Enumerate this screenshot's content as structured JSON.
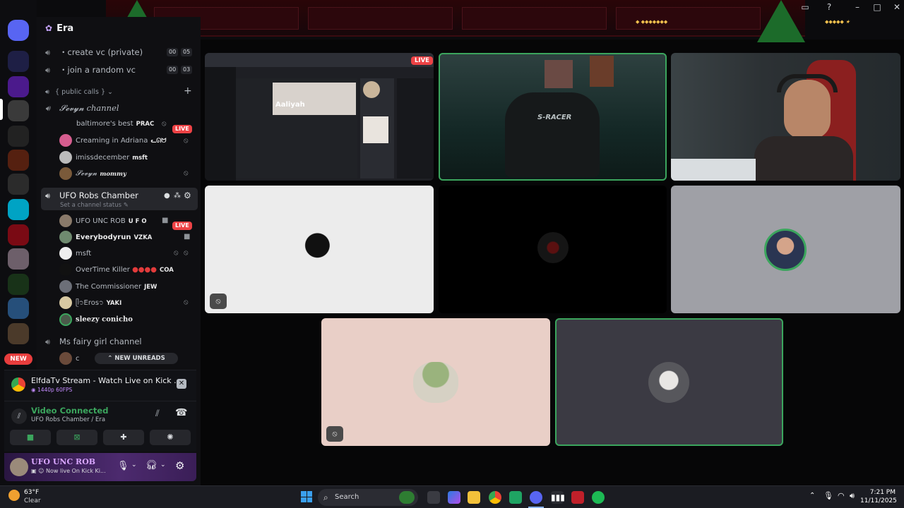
{
  "server": {
    "name": "Era"
  },
  "voice_channels": [
    {
      "label": "・create vc (private)",
      "count_a": "00",
      "count_b": "05"
    },
    {
      "label": "・join a random vc",
      "count_a": "00",
      "count_b": "03"
    }
  ],
  "category": {
    "label": "{ public calls }"
  },
  "sevyn_channel": {
    "label": "𝓢𝓮𝓿𝔂𝓷 channel",
    "members": [
      {
        "name": "baltimore's best",
        "tag": "PRAC",
        "live": "LIVE"
      },
      {
        "name": "Creaming in Adriana",
        "tag": "ᓚᘏᗢ"
      },
      {
        "name": "imissdecember",
        "tag": "msft"
      },
      {
        "name": "𝓢𝓮𝓿𝔂𝓷",
        "tag": "mommy"
      }
    ]
  },
  "active_channel": {
    "label": "UFO Robs Chamber",
    "status_placeholder": "Set a channel status",
    "members": [
      {
        "name": "UFO UNC ROB",
        "tag": "U F O",
        "live": "LIVE"
      },
      {
        "name": "Everybodyrun",
        "tag": "VZKA"
      },
      {
        "name": "msft",
        "tag": ""
      },
      {
        "name": "OverTime Killer",
        "tag": "COA"
      },
      {
        "name": "The Commissioner",
        "tag": "JEW"
      },
      {
        "name": "ᥫ᭡Eros᭡",
        "tag": "YAKI"
      },
      {
        "name": "sleezy conicho",
        "tag": ""
      }
    ]
  },
  "fairy_channel": {
    "label": "Ms fairy girl channel",
    "member": "c"
  },
  "new_unreads": "NEW UNREADS",
  "new_badge": "NEW",
  "stream_card": {
    "title": "ElfdaTv Stream - Watch Live on Kick ...",
    "quality": "1440p 60FPS"
  },
  "voice_panel": {
    "status": "Video Connected",
    "location": "UFO Robs Chamber / Era"
  },
  "user_bar": {
    "name": "UFO UNC ROB",
    "status": "Now live On Kick Ki..."
  },
  "video": {
    "live_label": "LIVE",
    "screen_share_title": "Aaliyah",
    "chair_text": "S-RACER"
  },
  "taskbar": {
    "weather_temp": "63°F",
    "weather_desc": "Clear",
    "search_label": "Search",
    "time": "7:21 PM",
    "date": "11/11/2025"
  },
  "colors": {
    "accent_green": "#3ba55d",
    "live_red": "#ed4245",
    "discord_blurple": "#5865f2"
  }
}
